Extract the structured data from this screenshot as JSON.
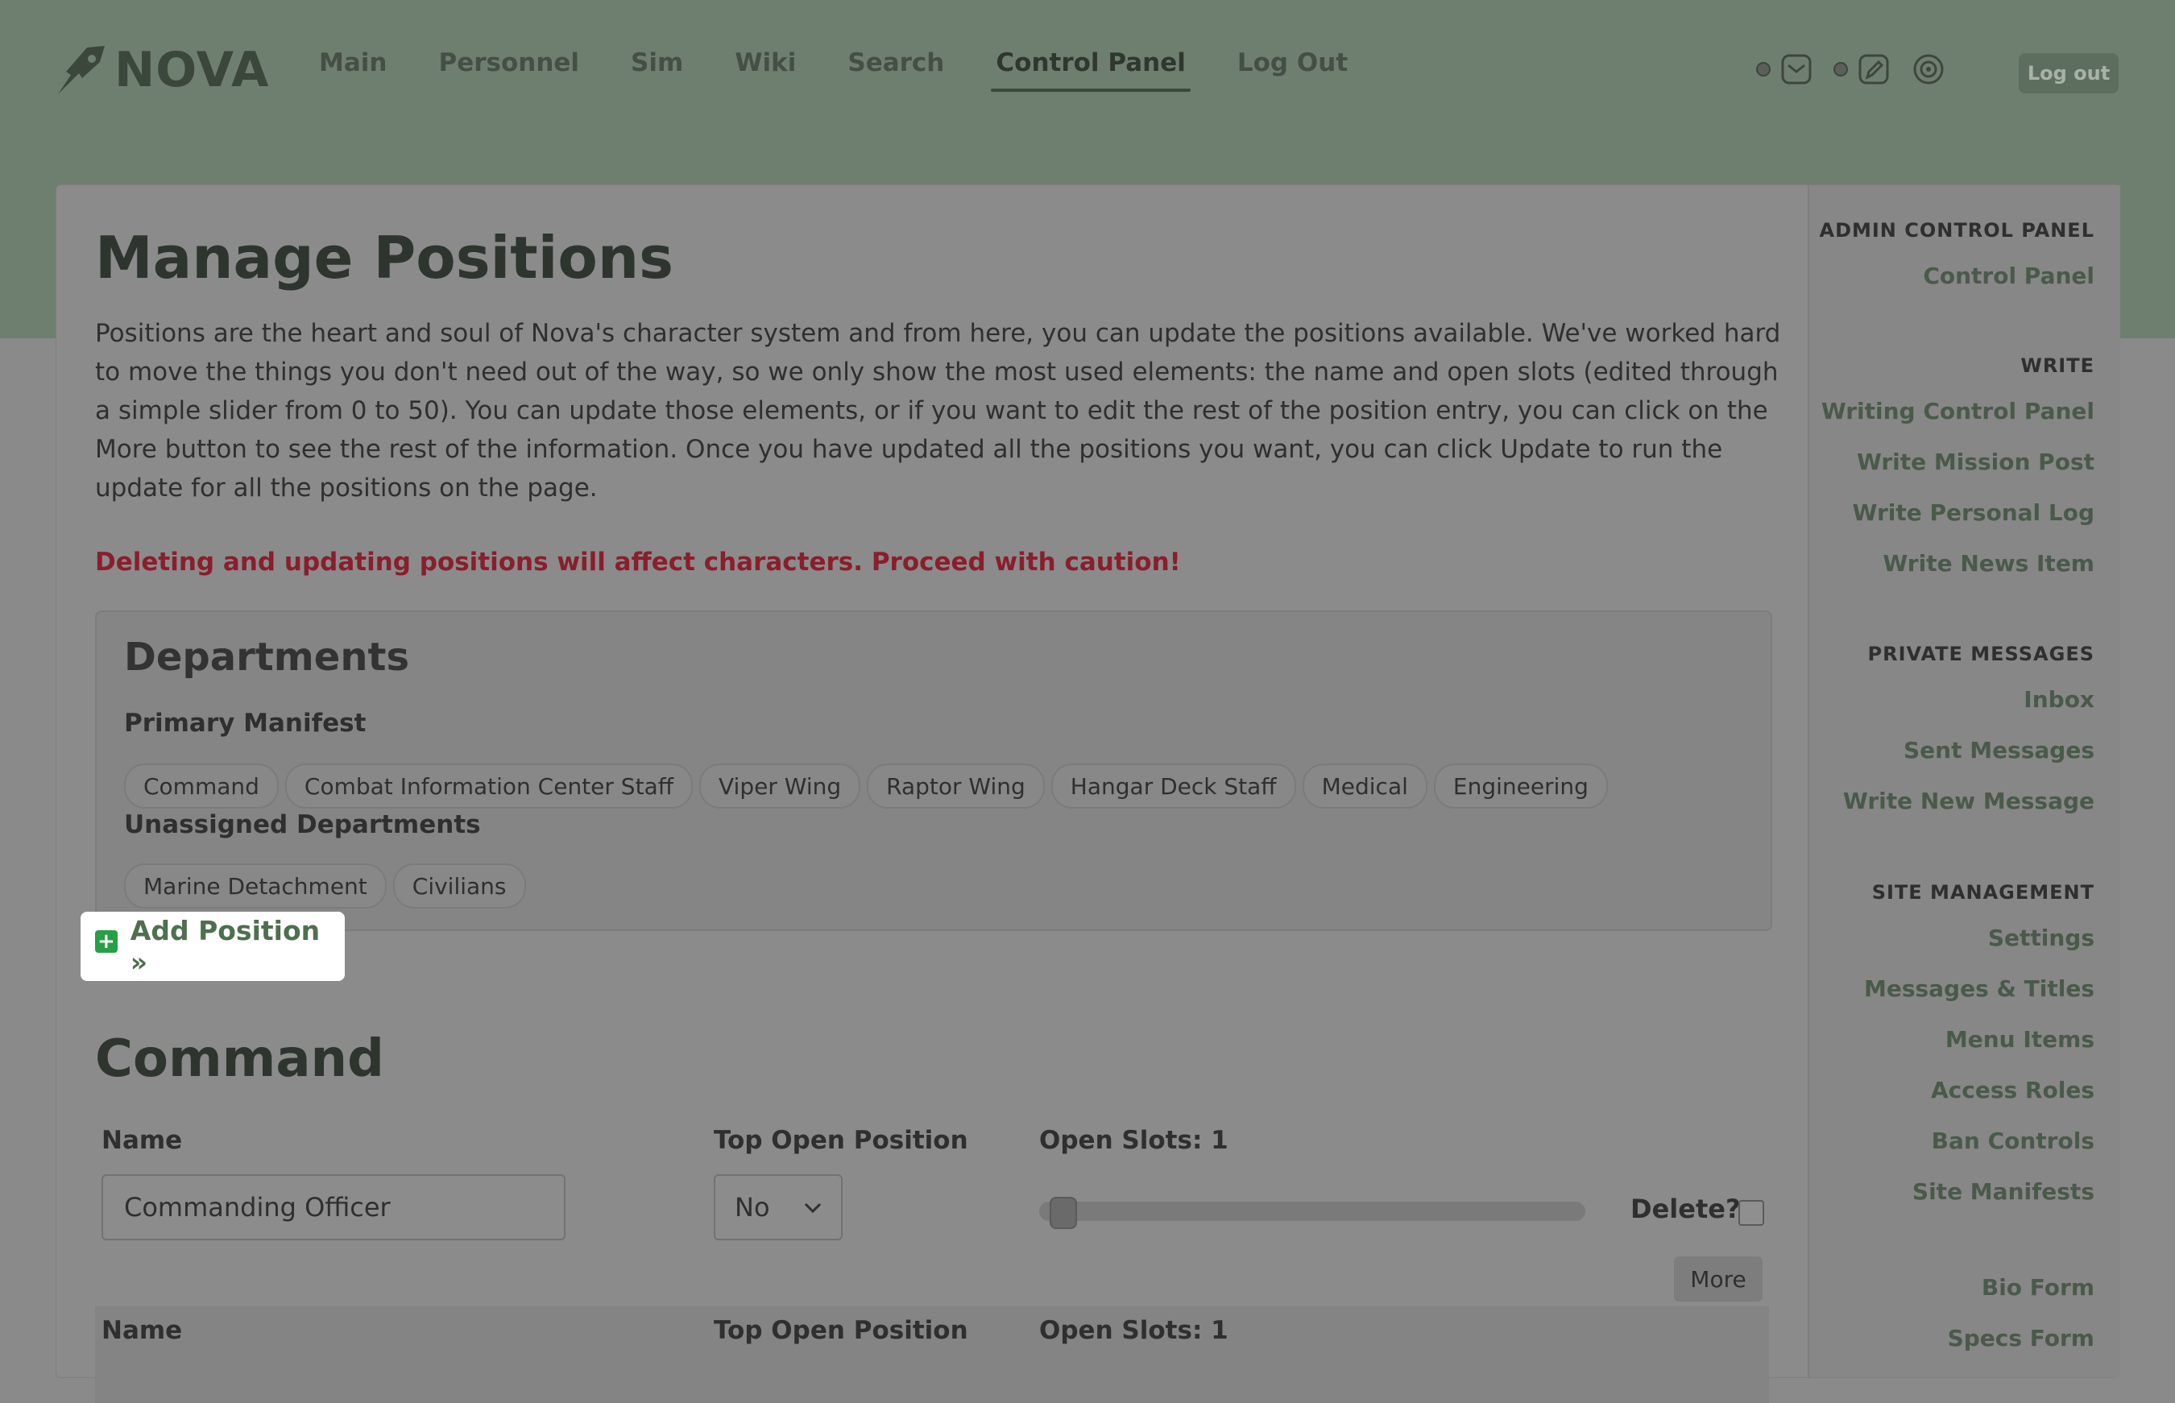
{
  "brand": {
    "name": "NOVA"
  },
  "nav": {
    "items": [
      {
        "label": "Main"
      },
      {
        "label": "Personnel"
      },
      {
        "label": "Sim"
      },
      {
        "label": "Wiki"
      },
      {
        "label": "Search"
      },
      {
        "label": "Control Panel",
        "active": true
      },
      {
        "label": "Log Out"
      }
    ]
  },
  "header_actions": {
    "icons": [
      "mail-icon",
      "pen-icon",
      "radar-icon"
    ],
    "logout_label": "Log out"
  },
  "page": {
    "title": "Manage Positions",
    "intro": "Positions are the heart and soul of Nova's character system and from here, you can update the positions available. We've worked hard to move the things you don't need out of the way, so we only show the most used elements: the name and open slots (edited through a simple slider from 0 to 50). You can update those elements, or if you want to edit the rest of the position entry, you can click on the More button to see the rest of the information. Once you have updated all the positions you want, you can click Update to run the update for all the positions on the page.",
    "warning": "Deleting and updating positions will affect characters. Proceed with caution!"
  },
  "departments": {
    "title": "Departments",
    "primary_label": "Primary Manifest",
    "primary": [
      "Command",
      "Combat Information Center Staff",
      "Viper Wing",
      "Raptor Wing",
      "Hangar Deck Staff",
      "Medical",
      "Engineering"
    ],
    "unassigned_label": "Unassigned Departments",
    "unassigned": [
      "Marine Detachment",
      "Civilians"
    ]
  },
  "add_position": {
    "label": "Add Position »"
  },
  "section": {
    "title": "Command",
    "name_label": "Name",
    "top_open_label": "Top Open Position",
    "open_slots_label": "Open Slots: 1",
    "open_slots_value": 1,
    "open_slots_max": 50,
    "position_name": "Commanding Officer",
    "top_open_value": "No",
    "delete_label": "Delete?",
    "more_label": "More",
    "row2_name_label": "Name",
    "row2_top_open_label": "Top Open Position",
    "row2_open_slots_label": "Open Slots: 1"
  },
  "sidebar": {
    "sections": [
      {
        "heading": "ADMIN CONTROL PANEL",
        "links": [
          "Control Panel"
        ]
      },
      {
        "heading": "WRITE",
        "links": [
          "Writing Control Panel",
          "Write Mission Post",
          "Write Personal Log",
          "Write News Item"
        ]
      },
      {
        "heading": "PRIVATE MESSAGES",
        "links": [
          "Inbox",
          "Sent Messages",
          "Write New Message"
        ]
      },
      {
        "heading": "SITE MANAGEMENT",
        "links": [
          "Settings",
          "Messages & Titles",
          "Menu Items",
          "Access Roles",
          "Ban Controls",
          "Site Manifests"
        ]
      },
      {
        "heading": "",
        "links": [
          "Bio Form",
          "Specs Form"
        ]
      }
    ]
  },
  "colors": {
    "header_band": "#6f7f6f",
    "overlay_gray": "#8a8a8a",
    "warning_red": "#8a1e2c",
    "add_icon_green": "#25a045"
  }
}
